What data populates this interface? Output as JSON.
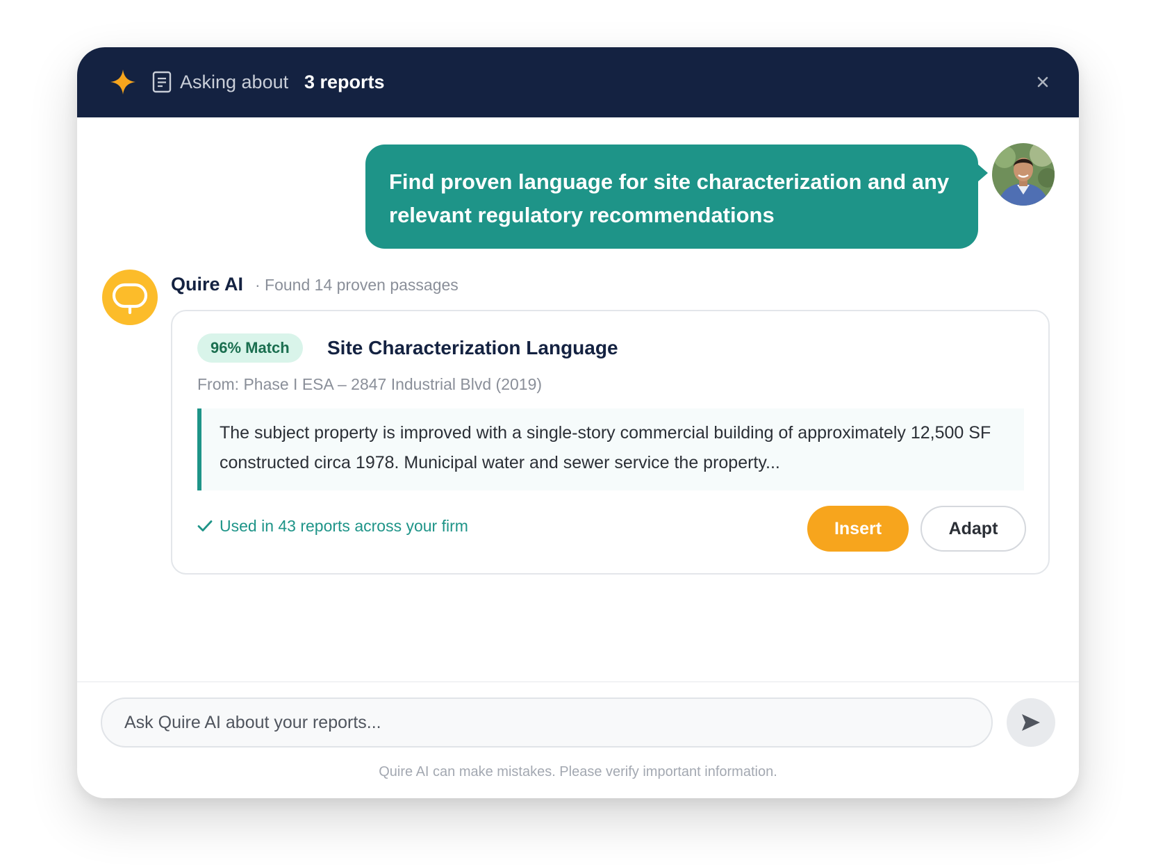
{
  "header": {
    "asking_label": "Asking about",
    "scope_label": "3 reports",
    "close_symbol": "×"
  },
  "user_message": {
    "text": "Find proven language for site characterization and any relevant regulatory recommendations"
  },
  "assistant": {
    "name": "Quire AI",
    "meta": "· Found 14 proven passages"
  },
  "result_card": {
    "match_badge": "96% Match",
    "title": "Site Characterization Language",
    "source": "From: Phase I ESA – 2847 Industrial Blvd (2019)",
    "excerpt": "The subject property is improved with a single-story commercial building of approximately 12,500 SF constructed circa 1978. Municipal water and sewer service the property...",
    "usage": "Used in 43 reports across your firm",
    "insert_label": "Insert",
    "adapt_label": "Adapt"
  },
  "composer": {
    "placeholder": "Ask Quire AI about your reports...",
    "disclaimer": "Quire AI can make mistakes. Please verify important information."
  },
  "colors": {
    "header_bg": "#142241",
    "accent_teal": "#1e9488",
    "accent_orange": "#f7a51d",
    "ai_avatar_yellow": "#fcbc2a"
  },
  "icons": [
    "sparkle-icon",
    "document-icon",
    "close-icon",
    "user-avatar",
    "chat-bubble-icon",
    "check-icon",
    "send-icon"
  ]
}
